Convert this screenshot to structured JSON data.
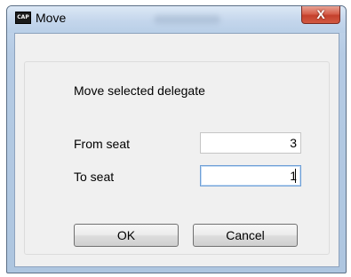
{
  "window": {
    "title": "Move",
    "app_icon_text": "CAP",
    "close_label": "X"
  },
  "dialog": {
    "heading": "Move selected delegate",
    "from_seat": {
      "label": "From seat",
      "value": "3"
    },
    "to_seat": {
      "label": "To seat",
      "value": "1"
    },
    "ok_label": "OK",
    "cancel_label": "Cancel"
  },
  "colors": {
    "titlebar": "#c4d6ec",
    "close_button": "#c4402c",
    "focus_border": "#6e9fd6"
  },
  "icons": [
    "app-logo-icon",
    "close-icon"
  ]
}
